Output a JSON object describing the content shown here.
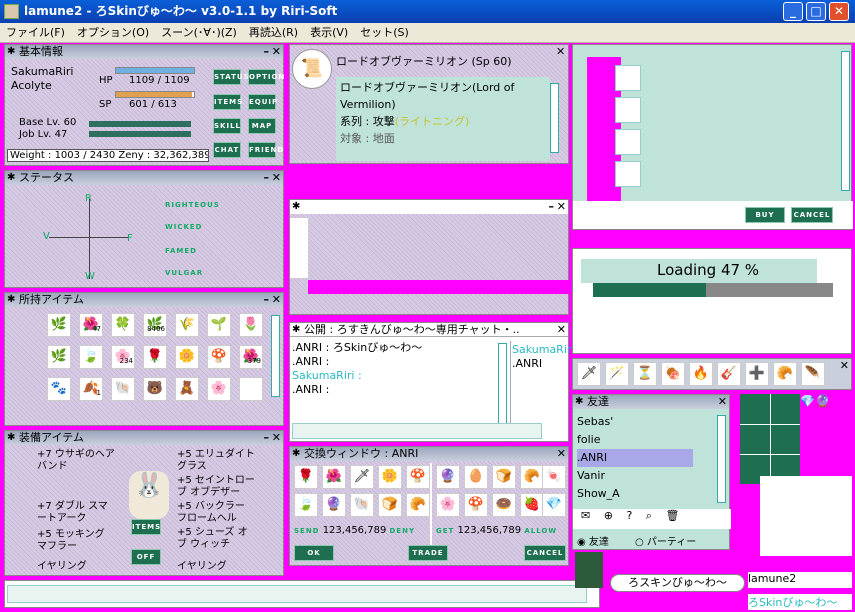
{
  "window": {
    "title": "lamune2 - ろSkinびゅ〜わ〜 v3.0-1.1 by Riri-Soft",
    "min": "_",
    "max": "□",
    "close": "✕"
  },
  "menu": [
    "ファイル(F)",
    "オプション(O)",
    "スーン(･∀･)(Z)",
    "再読込(R)",
    "表示(V)",
    "セット(S)"
  ],
  "basic": {
    "title": "基本情報",
    "name": "SakumaRiri",
    "job": "Acolyte",
    "hp_label": "HP",
    "hp": "1109 / 1109",
    "sp_label": "SP",
    "sp": "601 / 613",
    "base": "Base Lv. 60",
    "joblv": "Job Lv. 47",
    "weight": "Weight : 1003 / 2430",
    "zeny": "Zeny : 32,362,389",
    "hp_frac": 1.0,
    "sp_frac": 0.98,
    "buttons": [
      "STATUS",
      "OPTION",
      "ITEMS",
      "EQUIP",
      "SKILL",
      "MAP",
      "CHAT",
      "FRIEND"
    ]
  },
  "status": {
    "title": "ステータス",
    "r": "R",
    "v": "V",
    "f": "F",
    "w": "W",
    "labels": [
      "RIGHTEOUS",
      "WICKED",
      "FAMED",
      "VULGAR"
    ]
  },
  "items": {
    "title": "所持アイテム",
    "counts": [
      "47",
      "8406",
      "234",
      "379",
      "1"
    ]
  },
  "equip": {
    "title": "装備アイテム",
    "left": [
      "+7 ウサギのヘアバンド",
      "+7 ダブル スマートアーク",
      "+5 モッキング マフラー",
      "イヤリング"
    ],
    "right": [
      "+5 エリュダイトグラス",
      "+5 セイントローブ オブデザー",
      "+5 バックラー フロームヘル",
      "+5 シューズ オブ ウィッチ",
      "イヤリング"
    ],
    "items_btn": "ITEMS",
    "off_btn": "OFF"
  },
  "skill": {
    "title": "ロードオブヴァーミリオン (Sp 60)",
    "name": "ロードオブヴァーミリオン(Lord of Vermilion)",
    "type_label": "系列 : 攻撃",
    "type_value": "(ライトニング)",
    "target": "対象 : 地面"
  },
  "chat": {
    "title": "公開 : ろすきんびゅ〜わ〜専用チャット・..",
    "lines": [
      ".ANRI : ろSkinびゅ〜わ〜",
      ".ANRI :",
      "SakumaRiri :",
      ".ANRI :"
    ],
    "side": [
      "SakumaRiri",
      ".ANRI"
    ]
  },
  "trade": {
    "title": "交換ウィンドウ : ANRI",
    "send_label": "SEND",
    "send": "123,456,789",
    "deny": "DENY",
    "get_label": "GET",
    "get": "123,456,789",
    "allow": "ALLOW",
    "ok": "OK",
    "trade": "TRADE",
    "cancel": "CANCEL",
    "counts_left": [
      "2",
      "379",
      "142",
      "14"
    ]
  },
  "shop": {
    "buy": "BUY",
    "cancel": "CANCEL"
  },
  "loading": {
    "text": "Loading 47 %",
    "frac": 0.47
  },
  "friends": {
    "title": "友達",
    "list": [
      "Sebas'",
      "folie",
      ".ANRI",
      "Vanir",
      "Show_A"
    ],
    "radio1": "友達",
    "radio2": "パーティー"
  },
  "hotbar": {
    "counts": [
      "1",
      "1",
      "142",
      "00:01",
      "1",
      "1"
    ]
  },
  "status_bar": {
    "chat": "ろスキンびゅ〜わ〜",
    "user": "lamune2",
    "skin": "ろSkinびゅ〜わ〜"
  }
}
